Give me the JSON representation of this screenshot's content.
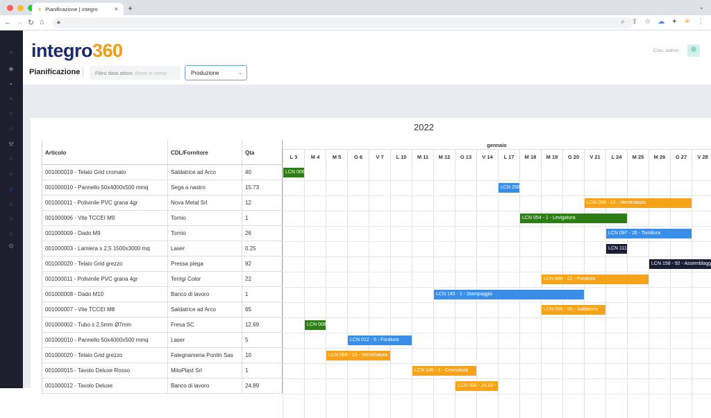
{
  "browser": {
    "tab_title": "Pianificazione | integro",
    "colors": {
      "close": "#ff5f57",
      "min": "#febc2e",
      "max": "#28c840"
    }
  },
  "header": {
    "logo_text": "integro",
    "logo_num": "360",
    "greeting": "Ciao, admin",
    "page_title": "Pianificazione",
    "filter_label": "Filtro data attivo: ",
    "filter_value": "Anno in corso",
    "select_value": "Produzione"
  },
  "year": "2022",
  "month": "gennaio",
  "columns": {
    "articolo": "Articolo",
    "cdl": "CDL/Fornitore",
    "qta": "Qta"
  },
  "days": [
    "L 3",
    "M 4",
    "M 5",
    "G 6",
    "V 7",
    "L 10",
    "M 11",
    "M 12",
    "G 13",
    "V 14",
    "L 17",
    "M 18",
    "M 19",
    "G 20",
    "V 21",
    "L 24",
    "M 25",
    "M 26",
    "G 27",
    "V 28"
  ],
  "rows": [
    {
      "articolo": "001000019 - Telaio Grid cromato",
      "cdl": "Saldatrice ad Arco",
      "qta": "40"
    },
    {
      "articolo": "001000010 - Pannello 50x4000x500 mmq",
      "cdl": "Sega a nastro",
      "qta": "15.73"
    },
    {
      "articolo": "001000011 - Polivinile PVC grana 4gr",
      "cdl": "Nova Metal Srl",
      "qta": "12"
    },
    {
      "articolo": "001000006 - Vite TCCEI M9",
      "cdl": "Tornio",
      "qta": "1"
    },
    {
      "articolo": "001000009 - Dado M9",
      "cdl": "Tornio",
      "qta": "26"
    },
    {
      "articolo": "001000003 - Lamiera s 2,5 1500x3000 mq",
      "cdl": "Laser",
      "qta": "0.25"
    },
    {
      "articolo": "001000020 - Telaio Grid grezzo",
      "cdl": "Pressa piega",
      "qta": "92"
    },
    {
      "articolo": "001000011 - Polivinile PVC grana 4gr",
      "cdl": "Terrigi Color",
      "qta": "22"
    },
    {
      "articolo": "001000008 - Dado M10",
      "cdl": "Banco di lavoro",
      "qta": "1"
    },
    {
      "articolo": "001000007 - Vite TCCEI M8",
      "cdl": "Saldatrice ad Arco",
      "qta": "65"
    },
    {
      "articolo": "001000002 - Tubo s 2,5mm Ø7mm",
      "cdl": "Fresa SC",
      "qta": "12.69"
    },
    {
      "articolo": "001000010 - Pannello 50x4000x500 mmq",
      "cdl": "Laser",
      "qta": "5"
    },
    {
      "articolo": "001000020 - Telaio Grid grezzo",
      "cdl": "Falegnameria Pontin Sas",
      "qta": "10"
    },
    {
      "articolo": "001000015 - Tavolo Deluxe Rosso",
      "cdl": "MitoPlast Srl",
      "qta": "1"
    },
    {
      "articolo": "001000012 - Tavolo Deluxe",
      "cdl": "Banco di lavoro",
      "qta": "24.89"
    }
  ],
  "bars": [
    {
      "row": 0,
      "start": 0,
      "span": 1,
      "label": "LCN 006",
      "color": "#2e7d16"
    },
    {
      "row": 1,
      "start": 10,
      "span": 1,
      "label": "LCN 258",
      "color": "#3b8ee8"
    },
    {
      "row": 2,
      "start": 14,
      "span": 5,
      "label": "LCN 098 - 12 - Verniciatura",
      "color": "#f5a31a"
    },
    {
      "row": 3,
      "start": 11,
      "span": 5,
      "label": "LCN 054 - 1 - Levigatura",
      "color": "#2e7d16"
    },
    {
      "row": 4,
      "start": 15,
      "span": 4,
      "label": "LCN 097 - 26 - Tornitura",
      "color": "#3b8ee8"
    },
    {
      "row": 5,
      "start": 15,
      "span": 1,
      "label": "LCN 111 -",
      "color": "#1a1d33"
    },
    {
      "row": 6,
      "start": 17,
      "span": 3,
      "label": "LCN 158 - 92 - Assemblagg",
      "color": "#1a1d33"
    },
    {
      "row": 7,
      "start": 12,
      "span": 5,
      "label": "LCN 686 - 22 - Foratura",
      "color": "#f5a31a"
    },
    {
      "row": 8,
      "start": 7,
      "span": 7,
      "label": "LCN 145 - 1 - Stampaggio",
      "color": "#3b8ee8"
    },
    {
      "row": 9,
      "start": 12,
      "span": 3,
      "label": "LCN 058 - 65 - Saldatura",
      "color": "#f5a31a"
    },
    {
      "row": 10,
      "start": 1,
      "span": 1,
      "label": "LCN 008",
      "color": "#2e7d16"
    },
    {
      "row": 11,
      "start": 3,
      "span": 3,
      "label": "LCN 012 - 5 - Foratura",
      "color": "#3b8ee8"
    },
    {
      "row": 12,
      "start": 2,
      "span": 3,
      "label": "LCN 069 - 10 - Verniciatura",
      "color": "#f5a31a"
    },
    {
      "row": 13,
      "start": 6,
      "span": 3,
      "label": "LCN 145 - 1 - Cromatura",
      "color": "#f5a31a"
    },
    {
      "row": 14,
      "start": 8,
      "span": 2,
      "label": "LCN 068 - 24.89 -",
      "color": "#f5a31a"
    }
  ]
}
